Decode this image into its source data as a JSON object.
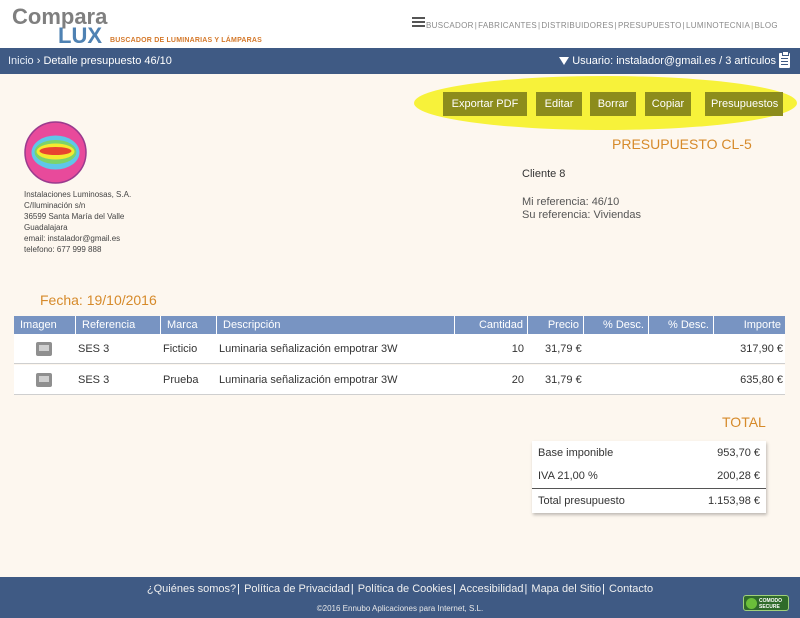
{
  "brand": {
    "top": "Compara",
    "lux": "LUX",
    "subtitle": "BUSCADOR DE LUMINARIAS Y LÁMPARAS"
  },
  "topnav": [
    "BUSCADOR",
    "FABRICANTES",
    "DISTRIBUIDORES",
    "PRESUPUESTO",
    "LUMINOTECNIA",
    "BLOG"
  ],
  "breadcrumb": {
    "home": "Inicio",
    "sep": "›",
    "current": "Detalle presupuesto 46/10"
  },
  "user": {
    "label": "Usuario: instalador@gmail.es",
    "sep": "/",
    "articles": "3 artículos"
  },
  "actions": {
    "export": "Exportar PDF",
    "edit": "Editar",
    "delete": "Borrar",
    "copy": "Copiar",
    "budgets": "Presupuestos"
  },
  "company": {
    "lines": [
      "Instalaciones Luminosas, S.A.",
      "C/Iluminación s/n",
      "36599 Santa María del Valle",
      "Guadalajara",
      "email: instalador@gmail.es",
      "telefono: 677 999 888"
    ]
  },
  "budget": {
    "title": "PRESUPUESTO CL-5",
    "client": "Cliente 8",
    "my_ref": "Mi referencia: 46/10",
    "your_ref": "Su referencia: Viviendas",
    "date": "Fecha: 19/10/2016"
  },
  "table": {
    "headers": [
      "Imagen",
      "Referencia",
      "Marca",
      "Descripción",
      "Cantidad",
      "Precio",
      "% Desc.",
      "% Desc.",
      "Importe"
    ],
    "rows": [
      {
        "ref": "SES 3",
        "brand": "Ficticio",
        "desc": "Luminaria señalización empotrar 3W",
        "qty": "10",
        "price": "31,79 €",
        "d1": "",
        "d2": "",
        "amount": "317,90 €"
      },
      {
        "ref": "SES 3",
        "brand": "Prueba",
        "desc": "Luminaria señalización empotrar 3W",
        "qty": "20",
        "price": "31,79 €",
        "d1": "",
        "d2": "",
        "amount": "635,80 €"
      }
    ]
  },
  "totals": {
    "title": "TOTAL",
    "base_label": "Base imponible",
    "base_value": "953,70 €",
    "iva_label": "IVA 21,00 %",
    "iva_value": "200,28 €",
    "total_label": "Total presupuesto",
    "total_value": "1.153,98 €"
  },
  "footer": {
    "links": [
      "¿Quiénes somos?",
      "Política de Privacidad",
      "Política de Cookies",
      "Accesibilidad",
      "Mapa del Sitio",
      "Contacto"
    ],
    "copyright": "©2016 Ennubo Aplicaciones para Internet, S.L.",
    "badge_line1": "COMODO",
    "badge_line2": "SECURE"
  }
}
